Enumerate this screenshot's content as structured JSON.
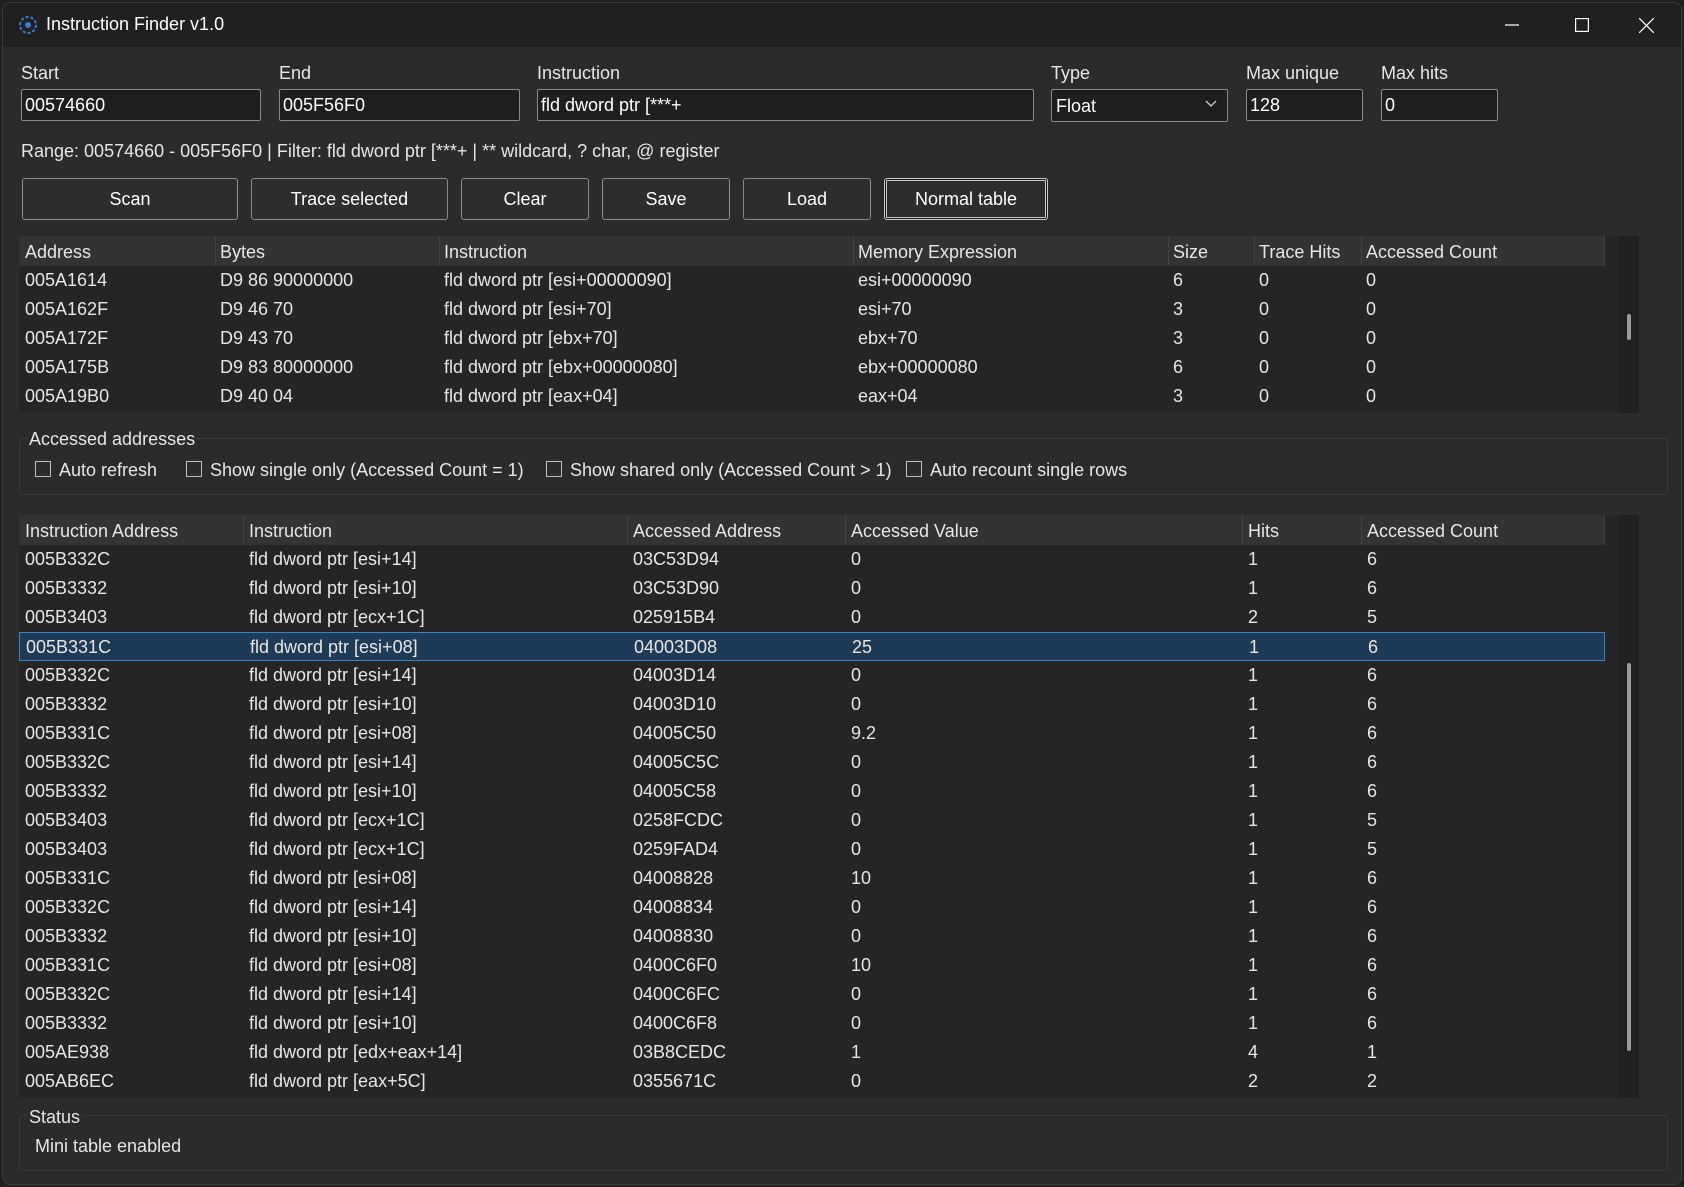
{
  "window": {
    "title": "Instruction Finder v1.0"
  },
  "form": {
    "start_label": "Start",
    "start_value": "00574660",
    "end_label": "End",
    "end_value": "005F56F0",
    "instruction_label": "Instruction",
    "instruction_value": "fld dword ptr [***+",
    "type_label": "Type",
    "type_value": "Float",
    "max_unique_label": "Max unique",
    "max_unique_value": "128",
    "max_hits_label": "Max hits",
    "max_hits_value": "0"
  },
  "info_line": "Range: 00574660 - 005F56F0 | Filter: fld dword ptr [***+ | ** wildcard, ? char, @ register",
  "toolbar": {
    "scan": "Scan",
    "trace_selected": "Trace selected",
    "clear": "Clear",
    "save": "Save",
    "load": "Load",
    "normal_table": "Normal table"
  },
  "results_table": {
    "columns": [
      "Address",
      "Bytes",
      "Instruction",
      "Memory Expression",
      "Size",
      "Trace Hits",
      "Accessed Count"
    ],
    "rows": [
      [
        "005A1614",
        "D9 86 90000000",
        "fld dword ptr [esi+00000090]",
        "esi+00000090",
        "6",
        "0",
        "0"
      ],
      [
        "005A162F",
        "D9 46 70",
        "fld dword ptr [esi+70]",
        "esi+70",
        "3",
        "0",
        "0"
      ],
      [
        "005A172F",
        "D9 43 70",
        "fld dword ptr [ebx+70]",
        "ebx+70",
        "3",
        "0",
        "0"
      ],
      [
        "005A175B",
        "D9 83 80000000",
        "fld dword ptr [ebx+00000080]",
        "ebx+00000080",
        "6",
        "0",
        "0"
      ],
      [
        "005A19B0",
        "D9 40 04",
        "fld dword ptr [eax+04]",
        "eax+04",
        "3",
        "0",
        "0"
      ]
    ]
  },
  "accessed": {
    "group_title": "Accessed addresses",
    "auto_refresh": "Auto refresh",
    "show_single": "Show single only (Accessed Count = 1)",
    "show_shared": "Show shared only (Accessed Count > 1)",
    "auto_recount": "Auto recount single rows"
  },
  "accessed_table": {
    "columns": [
      "Instruction Address",
      "Instruction",
      "Accessed Address",
      "Accessed Value",
      "Hits",
      "Accessed Count"
    ],
    "selected_row": 3,
    "rows": [
      [
        "005B332C",
        "fld dword ptr [esi+14]",
        "03C53D94",
        "0",
        "1",
        "6"
      ],
      [
        "005B3332",
        "fld dword ptr [esi+10]",
        "03C53D90",
        "0",
        "1",
        "6"
      ],
      [
        "005B3403",
        "fld dword ptr [ecx+1C]",
        "025915B4",
        "0",
        "2",
        "5"
      ],
      [
        "005B331C",
        "fld dword ptr [esi+08]",
        "04003D08",
        "25",
        "1",
        "6"
      ],
      [
        "005B332C",
        "fld dword ptr [esi+14]",
        "04003D14",
        "0",
        "1",
        "6"
      ],
      [
        "005B3332",
        "fld dword ptr [esi+10]",
        "04003D10",
        "0",
        "1",
        "6"
      ],
      [
        "005B331C",
        "fld dword ptr [esi+08]",
        "04005C50",
        "9.2",
        "1",
        "6"
      ],
      [
        "005B332C",
        "fld dword ptr [esi+14]",
        "04005C5C",
        "0",
        "1",
        "6"
      ],
      [
        "005B3332",
        "fld dword ptr [esi+10]",
        "04005C58",
        "0",
        "1",
        "6"
      ],
      [
        "005B3403",
        "fld dword ptr [ecx+1C]",
        "0258FCDC",
        "0",
        "1",
        "5"
      ],
      [
        "005B3403",
        "fld dword ptr [ecx+1C]",
        "0259FAD4",
        "0",
        "1",
        "5"
      ],
      [
        "005B331C",
        "fld dword ptr [esi+08]",
        "04008828",
        "10",
        "1",
        "6"
      ],
      [
        "005B332C",
        "fld dword ptr [esi+14]",
        "04008834",
        "0",
        "1",
        "6"
      ],
      [
        "005B3332",
        "fld dword ptr [esi+10]",
        "04008830",
        "0",
        "1",
        "6"
      ],
      [
        "005B331C",
        "fld dword ptr [esi+08]",
        "0400C6F0",
        "10",
        "1",
        "6"
      ],
      [
        "005B332C",
        "fld dword ptr [esi+14]",
        "0400C6FC",
        "0",
        "1",
        "6"
      ],
      [
        "005B3332",
        "fld dword ptr [esi+10]",
        "0400C6F8",
        "0",
        "1",
        "6"
      ],
      [
        "005AE938",
        "fld dword ptr [edx+eax+14]",
        "03B8CEDC",
        "1",
        "4",
        "1"
      ],
      [
        "005AB6EC",
        "fld dword ptr [eax+5C]",
        "0355671C",
        "0",
        "2",
        "2"
      ]
    ]
  },
  "status": {
    "title": "Status",
    "text": "Mini table enabled"
  }
}
